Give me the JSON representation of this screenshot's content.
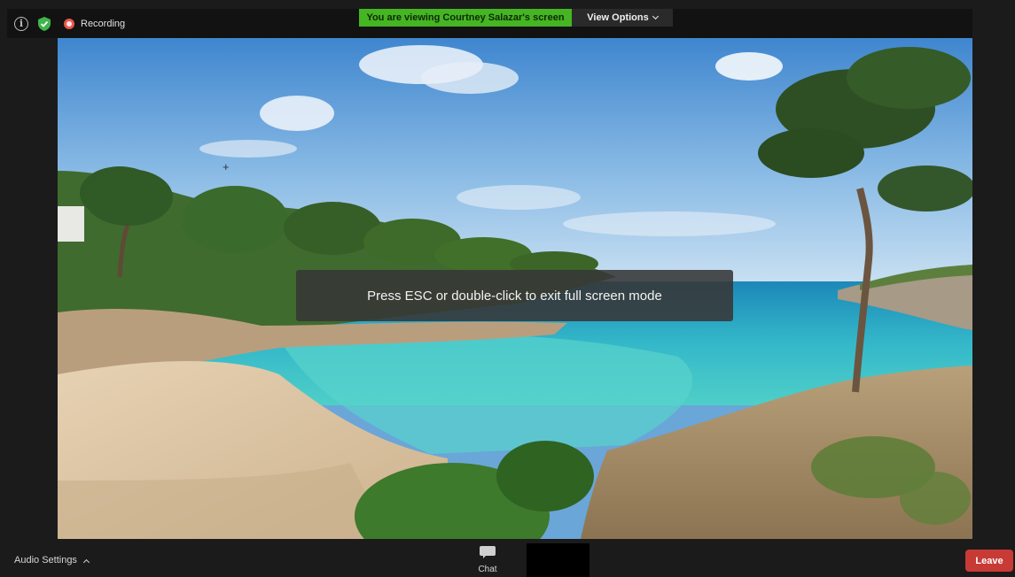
{
  "top_bar": {
    "recording_label": "Recording",
    "viewing_banner": "You are viewing Courtney Salazar's screen",
    "view_options_label": "View Options"
  },
  "overlay": {
    "toast_text": "Press ESC or double-click to exit full screen mode"
  },
  "bottom_bar": {
    "audio_settings_label": "Audio Settings",
    "chat_label": "Chat",
    "leave_label": "Leave"
  },
  "icons": [
    "info-icon",
    "shield-check-icon",
    "record-icon",
    "chevron-down-icon",
    "chevron-up-icon",
    "chat-bubble-icon"
  ],
  "colors": {
    "banner_green": "#45b523",
    "leave_red": "#c83a36",
    "bar_background": "#121212"
  }
}
